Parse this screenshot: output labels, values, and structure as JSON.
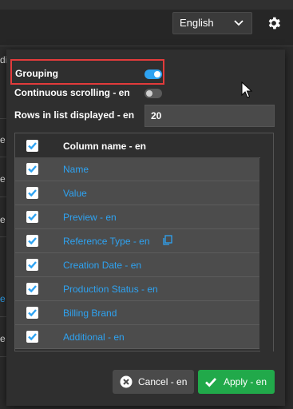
{
  "header": {
    "language": "English",
    "language_icon": "chevron-down-icon",
    "settings_icon": "gear-icon"
  },
  "background_fragments": [
    "di",
    "e",
    "e",
    "e",
    "e",
    "e"
  ],
  "settings": {
    "grouping": {
      "label": "Grouping",
      "enabled": true
    },
    "continuous_scrolling": {
      "label": "Continuous scrolling - en",
      "enabled": false
    },
    "rows_displayed": {
      "label": "Rows in list displayed - en",
      "value": "20"
    }
  },
  "table": {
    "header": "Column name - en",
    "rows": [
      {
        "name": "Name",
        "checked": true
      },
      {
        "name": "Value",
        "checked": true
      },
      {
        "name": "Preview - en",
        "checked": true
      },
      {
        "name": "Reference Type - en",
        "checked": true,
        "icon": "copy-icon"
      },
      {
        "name": "Creation Date - en",
        "checked": true
      },
      {
        "name": "Production Status - en",
        "checked": true
      },
      {
        "name": "Billing Brand",
        "checked": true
      },
      {
        "name": "Additional - en",
        "checked": true
      }
    ]
  },
  "buttons": {
    "cancel": "Cancel - en",
    "apply": "Apply - en"
  },
  "colors": {
    "accent": "#2ea3f2",
    "apply": "#21a94a",
    "highlight": "#e23b3b"
  }
}
